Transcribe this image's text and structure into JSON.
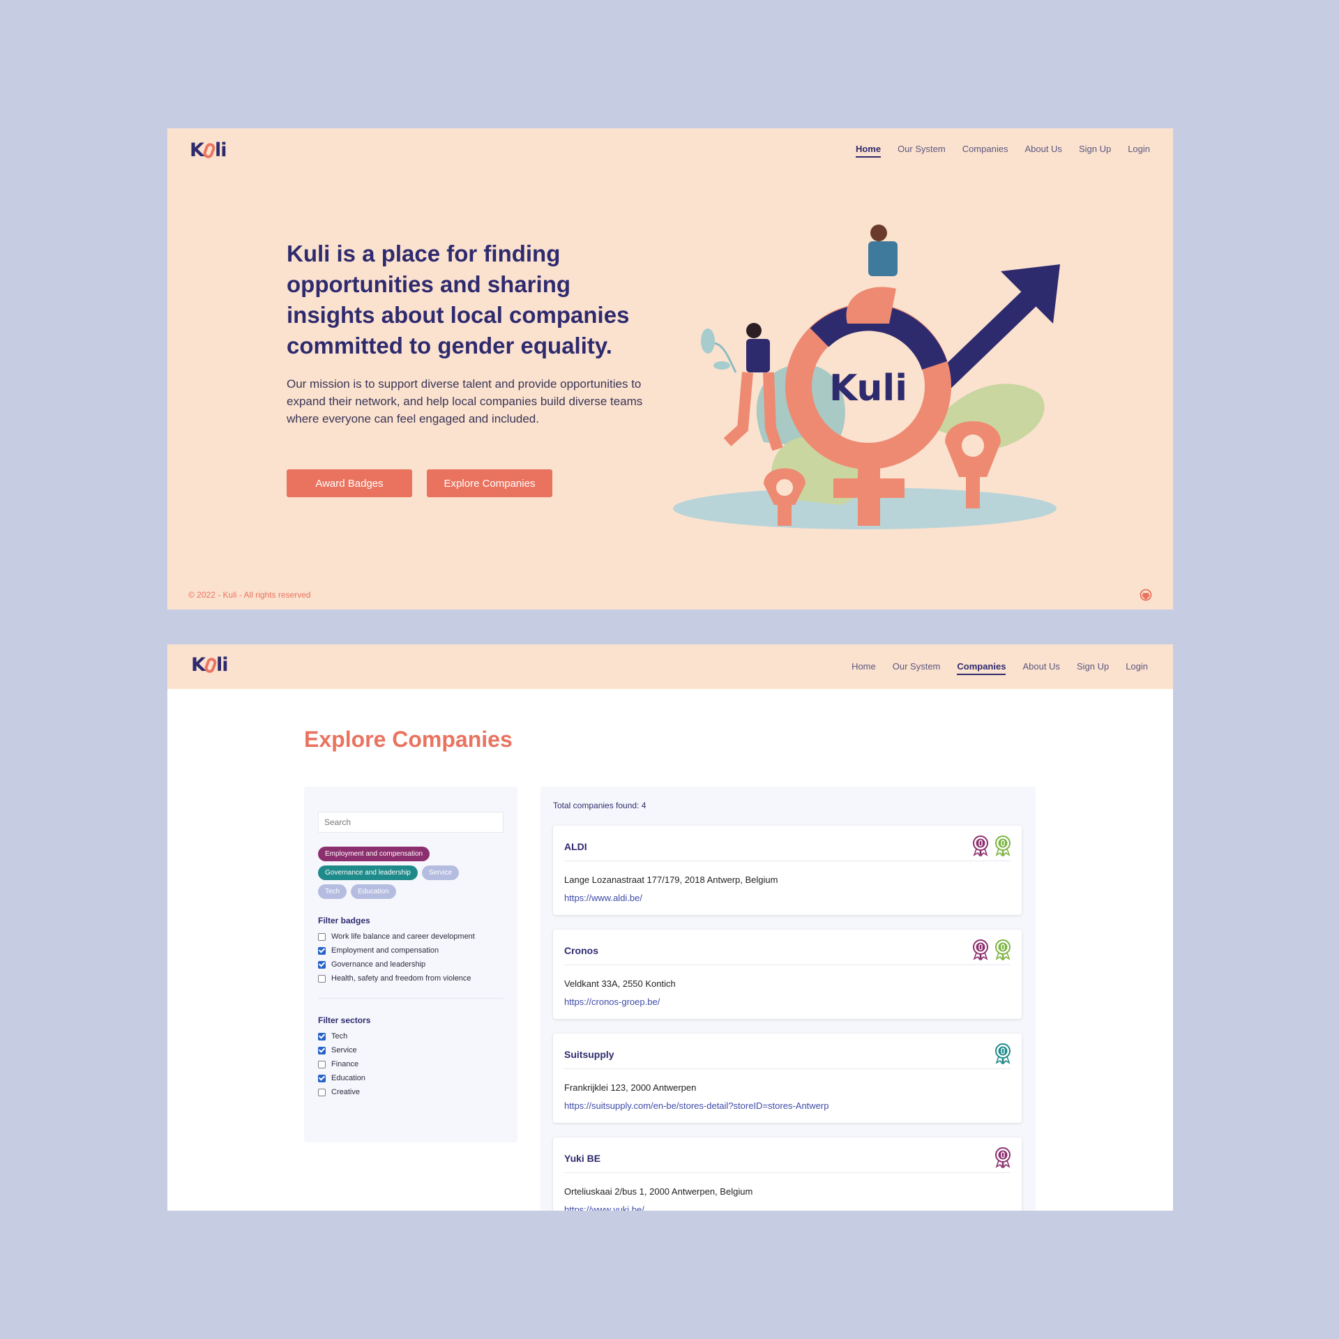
{
  "brand": {
    "logo_text_left": "K",
    "logo_text_right": "li"
  },
  "home": {
    "nav": [
      {
        "label": "Home",
        "active": true
      },
      {
        "label": "Our System",
        "active": false
      },
      {
        "label": "Companies",
        "active": false
      },
      {
        "label": "About Us",
        "active": false
      },
      {
        "label": "Sign Up",
        "active": false
      },
      {
        "label": "Login",
        "active": false
      }
    ],
    "title": "Kuli is a place for finding opportunities and sharing insights about local companies committed to gender equality.",
    "mission": "Our mission is to support diverse talent and provide opportunities to expand their network, and help local companies build diverse teams where everyone can feel engaged and included.",
    "buttons": {
      "award": "Award Badges",
      "explore": "Explore Companies"
    },
    "footer": "© 2022 - Kuli - All rights reserved",
    "illustration_logo": "Kuli"
  },
  "companies": {
    "nav": [
      {
        "label": "Home",
        "active": false
      },
      {
        "label": "Our System",
        "active": false
      },
      {
        "label": "Companies",
        "active": true
      },
      {
        "label": "About Us",
        "active": false
      },
      {
        "label": "Sign Up",
        "active": false
      },
      {
        "label": "Login",
        "active": false
      }
    ],
    "title": "Explore Companies",
    "search_placeholder": "Search",
    "chips": [
      {
        "label": "Employment and compensation",
        "color": "#8c2f6e"
      },
      {
        "label": "Governance and leadership",
        "color": "#1f8a8a"
      },
      {
        "label": "Service",
        "color": "#b4bde0"
      },
      {
        "label": "Tech",
        "color": "#b4bde0"
      },
      {
        "label": "Education",
        "color": "#b4bde0"
      }
    ],
    "filter_badges_title": "Filter badges",
    "filter_badges": [
      {
        "label": "Work life balance and career development",
        "checked": false
      },
      {
        "label": "Employment and compensation",
        "checked": true
      },
      {
        "label": "Governance and leadership",
        "checked": true
      },
      {
        "label": "Health, safety and freedom from violence",
        "checked": false
      }
    ],
    "filter_sectors_title": "Filter sectors",
    "filter_sectors": [
      {
        "label": "Tech",
        "checked": true
      },
      {
        "label": "Service",
        "checked": true
      },
      {
        "label": "Finance",
        "checked": false
      },
      {
        "label": "Education",
        "checked": true
      },
      {
        "label": "Creative",
        "checked": false
      }
    ],
    "total_label": "Total companies found: 4",
    "list": [
      {
        "name": "ALDI",
        "address": "Lange Lozanastraat 177/179, 2018 Antwerp, Belgium",
        "url": "https://www.aldi.be/",
        "badges": [
          "#8c2f6e",
          "#7cb342"
        ]
      },
      {
        "name": "Cronos",
        "address": "Veldkant 33A, 2550 Kontich",
        "url": "https://cronos-groep.be/",
        "badges": [
          "#8c2f6e",
          "#7cb342"
        ]
      },
      {
        "name": "Suitsupply",
        "address": "Frankrijklei 123, 2000 Antwerpen",
        "url": "https://suitsupply.com/en-be/stores-detail?storeID=stores-Antwerp",
        "badges": [
          "#1f8a8a"
        ]
      },
      {
        "name": "Yuki BE",
        "address": "Orteliuskaai 2/bus 1, 2000 Antwerpen, Belgium",
        "url": "https://www.yuki.be/",
        "badges": [
          "#8c2f6e"
        ]
      }
    ]
  }
}
